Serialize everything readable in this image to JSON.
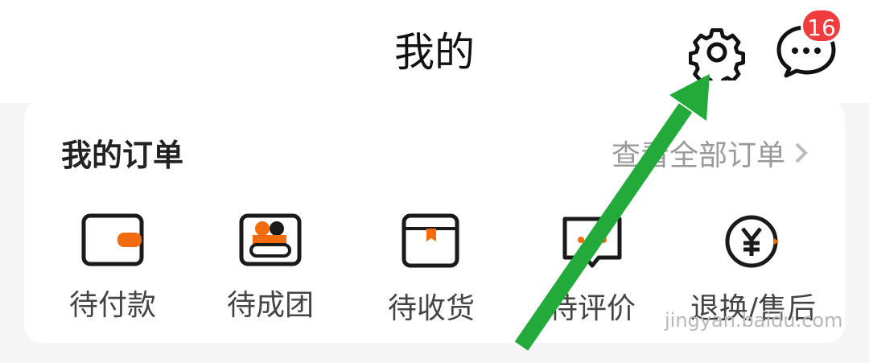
{
  "header": {
    "title": "我的",
    "badge_count": "16"
  },
  "orders_section": {
    "title": "我的订单",
    "view_all_label": "查看全部订单",
    "items": [
      {
        "label": "待付款",
        "icon": "wallet-icon"
      },
      {
        "label": "待成团",
        "icon": "group-icon"
      },
      {
        "label": "待收货",
        "icon": "package-icon"
      },
      {
        "label": "待评价",
        "icon": "review-icon"
      },
      {
        "label": "退换/售后",
        "icon": "refund-icon"
      }
    ]
  },
  "watermark": "jingyan.baidu.com",
  "colors": {
    "accent": "#f26b0f",
    "annotation_arrow": "#22aa3a",
    "badge": "#f03c3c"
  }
}
